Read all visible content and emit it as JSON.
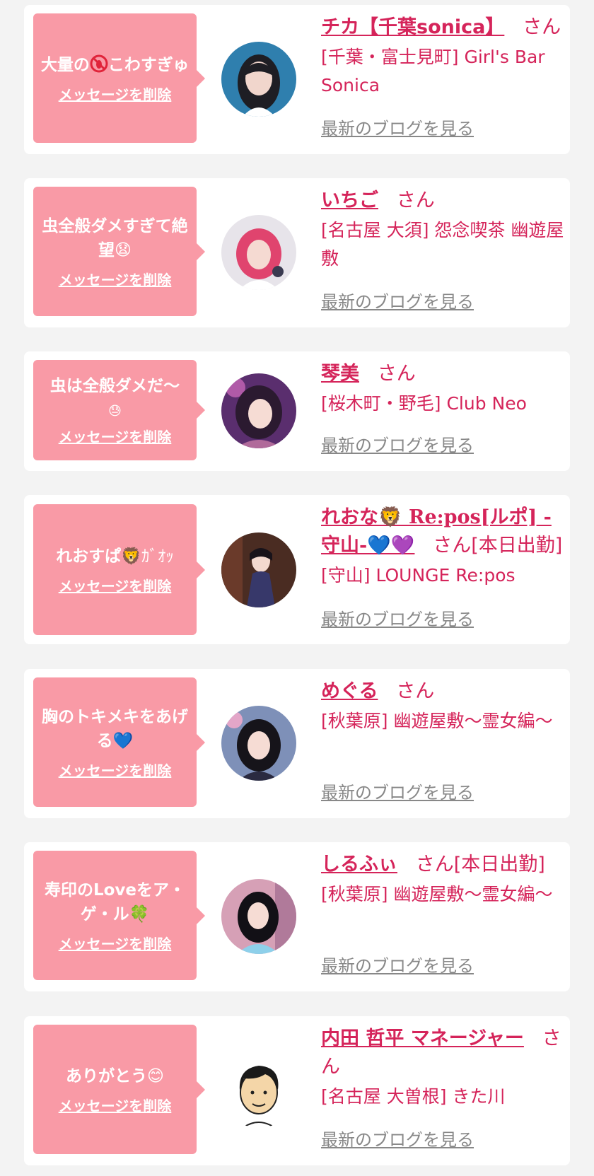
{
  "colors": {
    "background": "#f3f3f3",
    "card": "#ffffff",
    "bubble": "#f99aa6",
    "accent": "#d5245a",
    "link_gray": "#888888"
  },
  "items": [
    {
      "message": "大量の",
      "message_emoji": "no-bugs-emoji",
      "message_tail": "こわすぎゅ",
      "delete_label": "メッセージを削除",
      "name": "チカ【千葉sonica】",
      "honorific": "さん",
      "status": "",
      "shop": "[千葉・富士見町] Girl's Bar Sonica",
      "blog_label": "最新のブログを見る",
      "avatar": "photo-avatar"
    },
    {
      "message": "虫全般ダメすぎて絶望",
      "message_emoji": "😧",
      "message_tail": "",
      "delete_label": "メッセージを削除",
      "name": "いちご",
      "honorific": "さん",
      "status": "",
      "shop": "[名古屋 大須] 怨念喫茶 幽遊屋敷",
      "blog_label": "最新のブログを見る",
      "avatar": "photo-avatar"
    },
    {
      "message": "虫は全般ダメだ〜",
      "message_emoji": "😓",
      "message_tail": "",
      "delete_label": "メッセージを削除",
      "name": "琴美",
      "honorific": "さん",
      "status": "",
      "shop": "[桜木町・野毛] Club Neo",
      "blog_label": "最新のブログを見る",
      "avatar": "photo-avatar"
    },
    {
      "message": "れおすぱ",
      "message_emoji": "🦁",
      "message_tail": "ｶﾞｵｯ",
      "delete_label": "メッセージを削除",
      "name": "れおな🦁 Re:pos[ルポ] -守山-💙💜",
      "honorific": "さん",
      "status": "[本日出勤]",
      "shop": "[守山] LOUNGE Re:pos",
      "blog_label": "最新のブログを見る",
      "avatar": "photo-avatar"
    },
    {
      "message": "胸のトキメキをあげる",
      "message_emoji": "💙",
      "message_tail": "",
      "delete_label": "メッセージを削除",
      "name": "めぐる",
      "honorific": "さん",
      "status": "",
      "shop": "[秋葉原] 幽遊屋敷〜霊女編〜",
      "blog_label": "最新のブログを見る",
      "avatar": "photo-avatar"
    },
    {
      "message": "寿印のLoveをア・ゲ・ル",
      "message_emoji": "🍀",
      "message_tail": "",
      "delete_label": "メッセージを削除",
      "name": "しるふぃ",
      "honorific": "さん",
      "status": "[本日出勤]",
      "shop": "[秋葉原] 幽遊屋敷〜霊女編〜",
      "blog_label": "最新のブログを見る",
      "avatar": "photo-avatar"
    },
    {
      "message": "ありがとう",
      "message_emoji": "😊",
      "message_tail": "",
      "delete_label": "メッセージを削除",
      "name": "内田 哲平 マネージャー",
      "honorific": "さん",
      "status": "",
      "shop": "[名古屋 大曽根] きた川",
      "blog_label": "最新のブログを見る",
      "avatar": "cartoon-avatar"
    }
  ]
}
